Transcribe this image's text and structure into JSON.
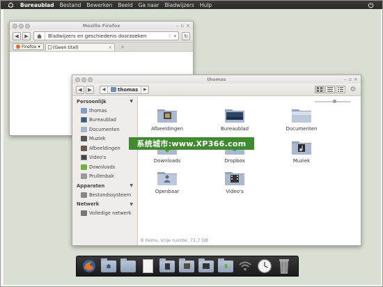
{
  "top_panel": {
    "active_app": "Bureaublad",
    "menus": [
      "Bestand",
      "Bewerken",
      "Beeld",
      "Ga naar",
      "Bladwijzers",
      "Hulp"
    ]
  },
  "firefox": {
    "title": "Mozilla Firefox",
    "url_text": "Bladwijzers en geschiedenis doorzoeken",
    "firefox_button": "Firefox",
    "tab_title": "(Geen titel)",
    "new_tab": "+"
  },
  "nautilus": {
    "title": "thomas",
    "breadcrumb": "thomas",
    "sidebar": {
      "sections": [
        {
          "heading": "Persoonlijk",
          "items": [
            {
              "label": "thomas",
              "icon": "home-folder-icon"
            },
            {
              "label": "Bureaublad",
              "icon": "desktop-icon"
            },
            {
              "label": "Documenten",
              "icon": "documents-icon"
            },
            {
              "label": "Muziek",
              "icon": "music-icon"
            },
            {
              "label": "Afbeeldingen",
              "icon": "pictures-icon"
            },
            {
              "label": "Video's",
              "icon": "video-icon"
            },
            {
              "label": "Downloads",
              "icon": "downloads-icon"
            },
            {
              "label": "Prullenbak",
              "icon": "trash-icon"
            }
          ]
        },
        {
          "heading": "Apparaten",
          "items": [
            {
              "label": "Bestandssysteem",
              "icon": "harddisk-icon"
            }
          ]
        },
        {
          "heading": "Netwerk",
          "items": [
            {
              "label": "Volledige netwerk",
              "icon": "network-icon"
            }
          ]
        }
      ]
    },
    "files": [
      {
        "label": "Afbeeldingen",
        "icon": "pictures-folder-icon"
      },
      {
        "label": "Bureaublad",
        "icon": "desktop-folder-icon"
      },
      {
        "label": "Documenten",
        "icon": "folder-icon"
      },
      {
        "label": "Downloads",
        "icon": "downloads-folder-icon"
      },
      {
        "label": "Dropbox",
        "icon": "dropbox-folder-icon"
      },
      {
        "label": "Muziek",
        "icon": "music-folder-icon"
      },
      {
        "label": "Openbaar",
        "icon": "public-folder-icon"
      },
      {
        "label": "Video's",
        "icon": "video-folder-icon"
      }
    ],
    "status": "8 items, Vrije ruimte: 71,7 GB",
    "zoom_level": 0.5
  },
  "watermark": "系统城市:www.XP366.com",
  "dock_items": [
    "firefox-icon",
    "home-folder-icon",
    "documents-folder-icon",
    "document-icon",
    "music-folder-icon",
    "pictures-folder-icon",
    "video-folder-icon",
    "downloads-folder-icon",
    "network-icon",
    "clock-icon",
    "trash-icon"
  ],
  "colors": {
    "panel": "#3c3b37",
    "desktop": "#d9dfd2",
    "folder": "#8ea3bd",
    "watermark_bg": "#3e8c2e"
  }
}
